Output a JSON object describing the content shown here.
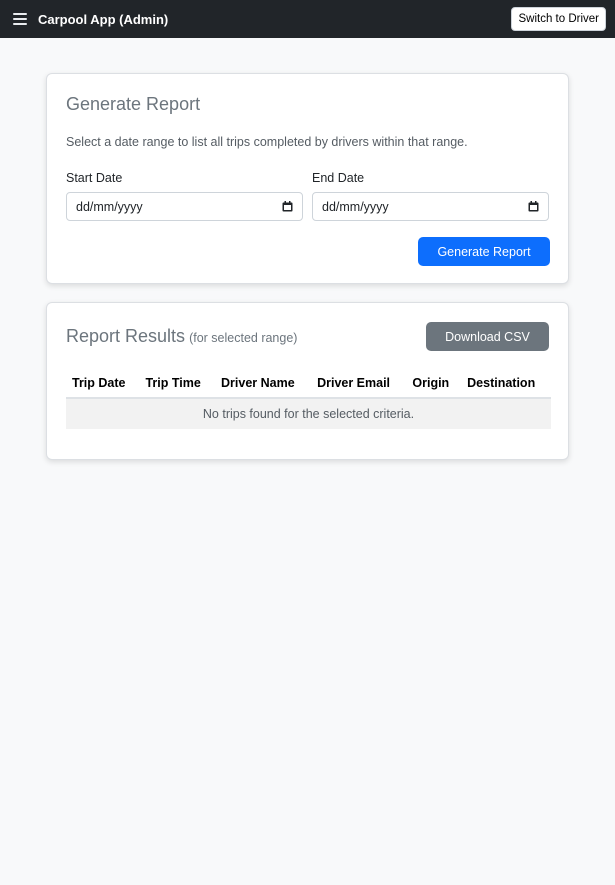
{
  "navbar": {
    "title": "Carpool App (Admin)",
    "switch_label": "Switch to Driver"
  },
  "generate": {
    "title": "Generate Report",
    "description": "Select a date range to list all trips completed by drivers within that range.",
    "start_label": "Start Date",
    "start_value": "dd/mm/yyyy",
    "end_label": "End Date",
    "end_value": "dd/mm/yyyy",
    "button_label": "Generate Report"
  },
  "results": {
    "title": "Report Results",
    "subtitle": "(for selected range)",
    "download_label": "Download CSV",
    "columns": [
      "Trip Date",
      "Trip Time",
      "Driver Name",
      "Driver Email",
      "Origin",
      "Destination"
    ],
    "empty_message": "No trips found for the selected criteria."
  },
  "colors": {
    "navbar_bg": "#212529",
    "primary": "#0d6efd",
    "secondary": "#6c757d"
  }
}
